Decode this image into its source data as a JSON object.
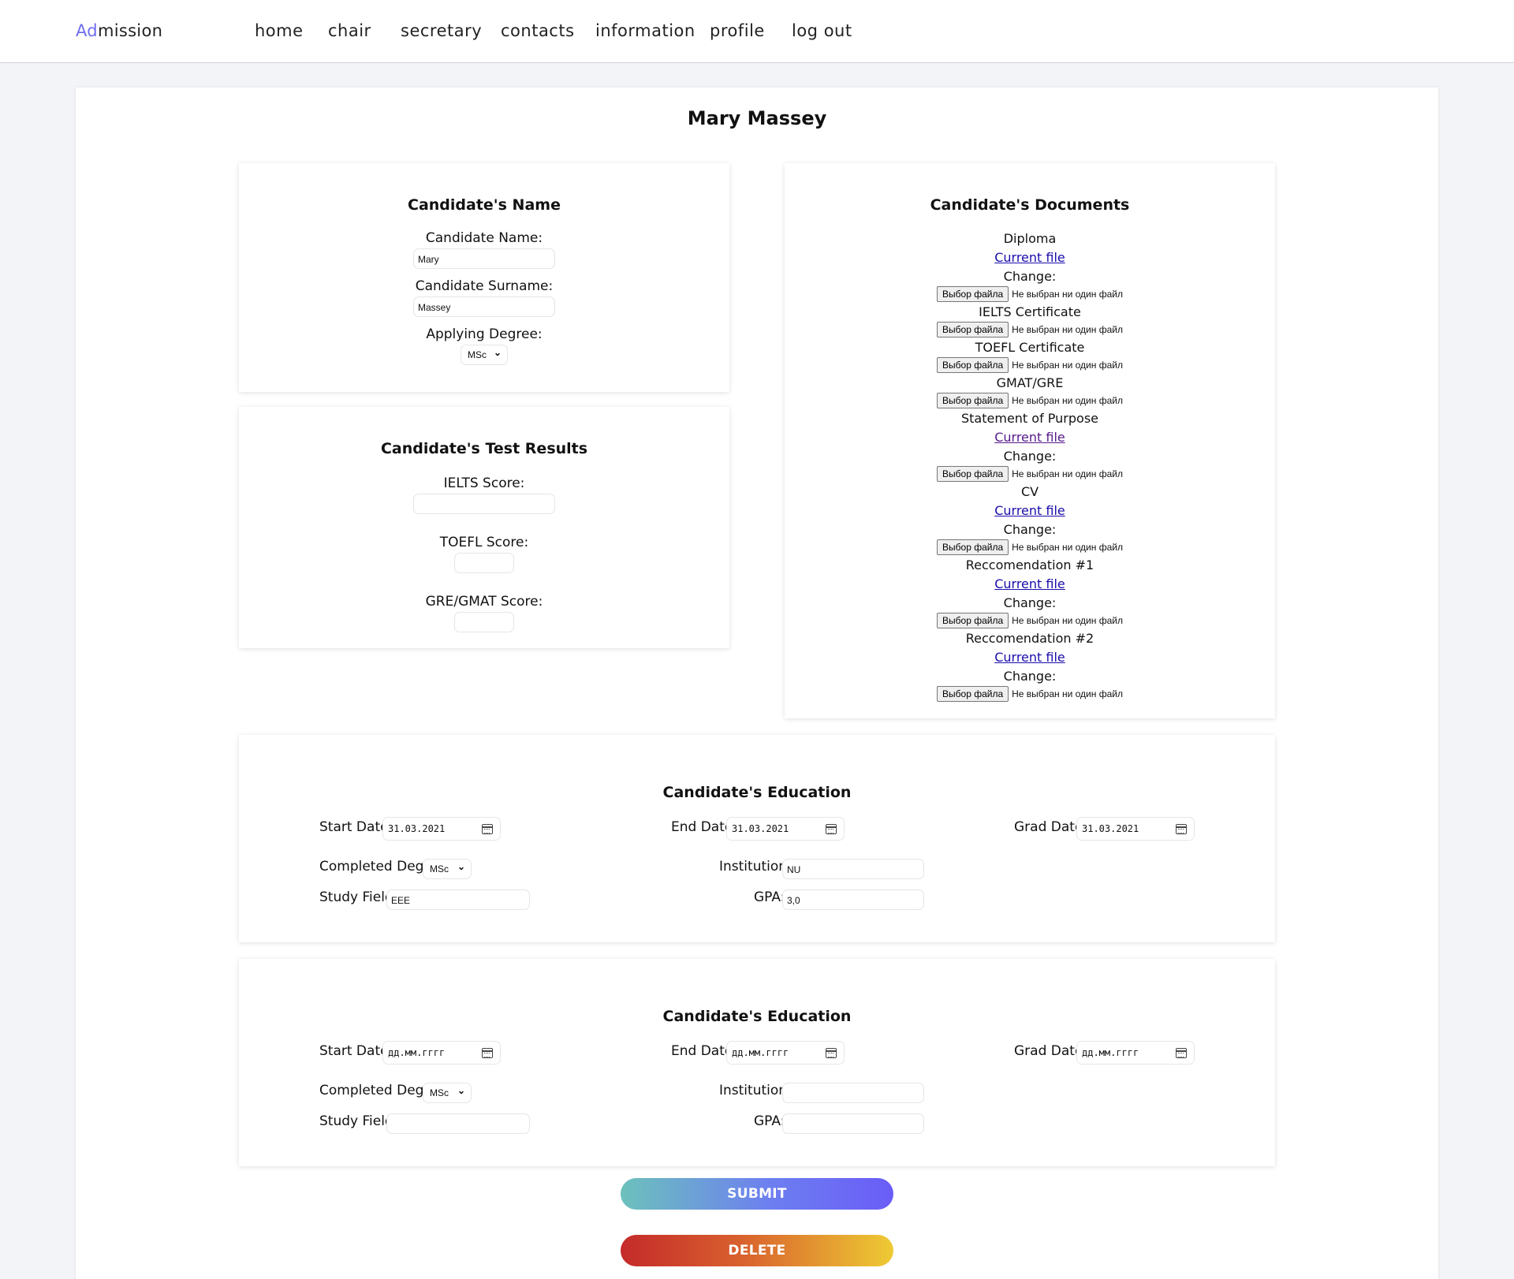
{
  "nav": {
    "brand_accent": "Ad",
    "brand_rest": "mission",
    "links": [
      "home",
      "chair",
      "secretary",
      "contacts",
      "information",
      "profile",
      "log out"
    ]
  },
  "page_title": "Mary Massey",
  "name_card": {
    "title": "Candidate's Name",
    "name_label": "Candidate Name:",
    "name_value": "Mary",
    "surname_label": "Candidate Surname:",
    "surname_value": "Massey",
    "degree_label": "Applying Degree:",
    "degree_value": "MSc"
  },
  "tests_card": {
    "title": "Candidate's Test Results",
    "ielts_label": "IELTS Score:",
    "ielts_value": "",
    "toefl_label": "TOEFL Score:",
    "toefl_value": "",
    "gre_label": "GRE/GMAT Score:",
    "gre_value": ""
  },
  "docs_card": {
    "title": "Candidate's Documents",
    "file_button": "Выбор файла",
    "no_file": "Не выбран ни один файл",
    "current_file": "Current file",
    "change": "Change:",
    "items": [
      "Diploma",
      "IELTS Certificate",
      "TOEFL Certificate",
      "GMAT/GRE",
      "Statement of Purpose",
      "CV",
      "Reccomendation #1",
      "Reccomendation #2"
    ]
  },
  "education": [
    {
      "title": "Candidate's Education",
      "start_label": "Start Date:",
      "start_value": "31.03.2021",
      "end_label": "End Date:",
      "end_value": "31.03.2021",
      "grad_label": "Grad Date:",
      "grad_value": "31.03.2021",
      "degree_label": "Completed Degree:",
      "degree_value": "MSc",
      "institution_label": "Institution:",
      "institution_value": "NU",
      "field_label": "Study Field:",
      "field_value": "EEE",
      "gpa_label": "GPA:",
      "gpa_value": "3,0"
    },
    {
      "title": "Candidate's Education",
      "start_label": "Start Date:",
      "start_value": "дд.мм.гггг",
      "end_label": "End Date:",
      "end_value": "дд.мм.гггг",
      "grad_label": "Grad Date:",
      "grad_value": "дд.мм.гггг",
      "degree_label": "Completed Degree:",
      "degree_value": "MSc",
      "institution_label": "Institution:",
      "institution_value": "",
      "field_label": "Study Field:",
      "field_value": "",
      "gpa_label": "GPA:",
      "gpa_value": ""
    }
  ],
  "buttons": {
    "submit": "SUBMIT",
    "delete": "DELETE"
  },
  "colors": {
    "accent": "#6f6cf0",
    "link": "#1a0dab",
    "link_visited": "#551a8b"
  }
}
